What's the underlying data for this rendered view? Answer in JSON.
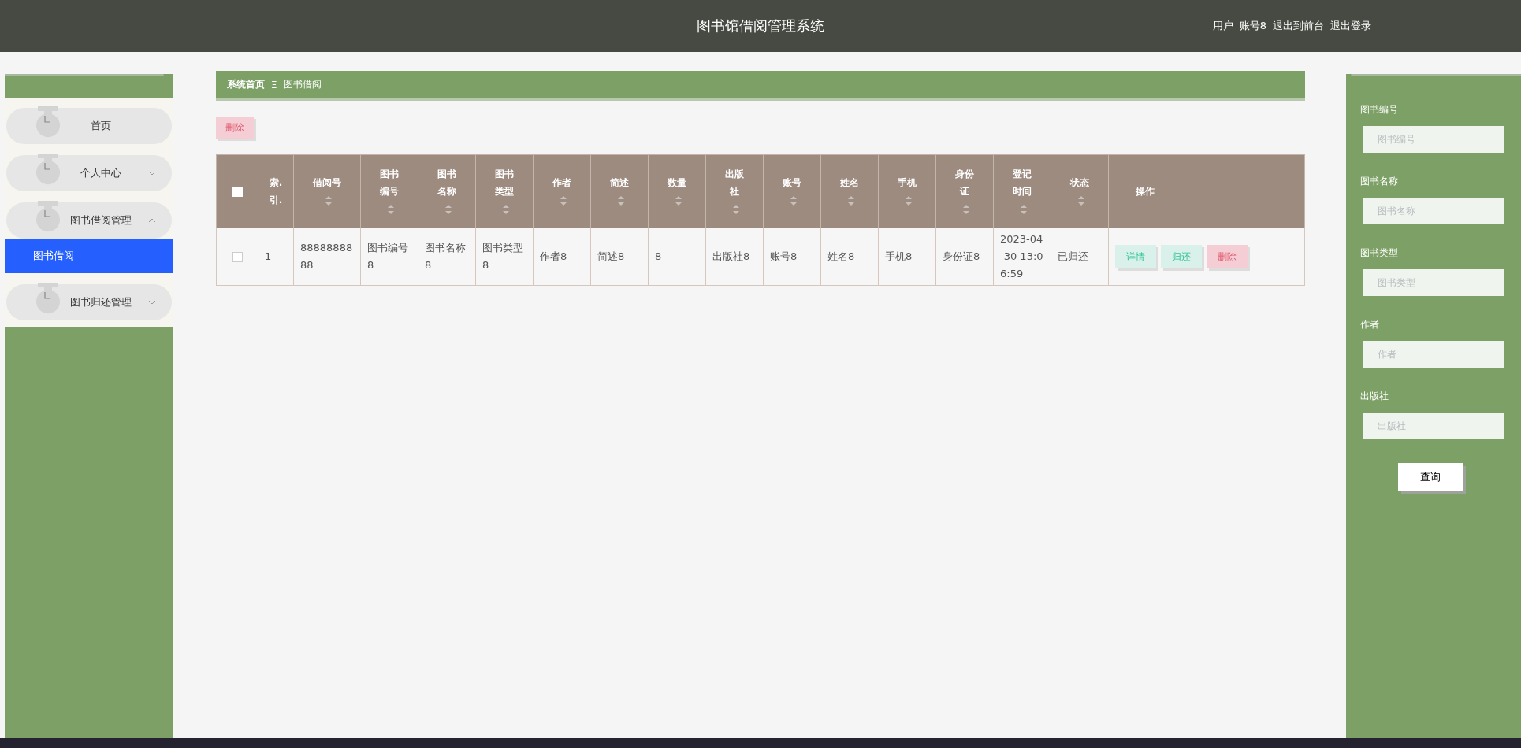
{
  "header": {
    "title": "图书馆借阅管理系统",
    "user_label": "用户",
    "user_name": "账号8",
    "links": [
      "退出到前台",
      "退出登录"
    ]
  },
  "sidebar": {
    "items": [
      {
        "kind": "link",
        "label": "首页"
      },
      {
        "kind": "group",
        "label": "个人中心",
        "expanded": false
      },
      {
        "kind": "group",
        "label": "图书借阅管理",
        "expanded": true,
        "children": [
          {
            "label": "图书借阅",
            "selected": true
          }
        ]
      },
      {
        "kind": "group",
        "label": "图书归还管理",
        "expanded": false
      }
    ]
  },
  "breadcrumb": {
    "items": [
      "系统首页",
      "图书借阅"
    ],
    "separator": "Ξ"
  },
  "toolbar": {
    "buttons": [
      {
        "kind": "delete",
        "label": "删除"
      }
    ]
  },
  "table": {
    "select_all_checked": false,
    "columns": [
      {
        "label": "索.引.",
        "sortable": false
      },
      {
        "label": "借阅号",
        "sortable": true
      },
      {
        "label": "图书编号",
        "sortable": true
      },
      {
        "label": "图书名称",
        "sortable": true
      },
      {
        "label": "图书类型",
        "sortable": true
      },
      {
        "label": "作者",
        "sortable": true
      },
      {
        "label": "简述",
        "sortable": true
      },
      {
        "label": "数量",
        "sortable": true
      },
      {
        "label": "出版社",
        "sortable": true
      },
      {
        "label": "账号",
        "sortable": true
      },
      {
        "label": "姓名",
        "sortable": true
      },
      {
        "label": "手机",
        "sortable": true
      },
      {
        "label": "身份证",
        "sortable": true
      },
      {
        "label": "登记时间",
        "sortable": true
      },
      {
        "label": "状态",
        "sortable": true
      },
      {
        "label": "操作",
        "sortable": false
      }
    ],
    "rows": [
      {
        "checked": false,
        "cells": [
          "1",
          "8888888888",
          "图书编号8",
          "图书名称8",
          "图书类型8",
          "作者8",
          "简述8",
          "8",
          "出版社8",
          "账号8",
          "姓名8",
          "手机8",
          "身份证8",
          "2023-04-30 13:06:59",
          "已归还"
        ],
        "actions": [
          {
            "kind": "detail",
            "label": "详情"
          },
          {
            "kind": "return",
            "label": "归还"
          },
          {
            "kind": "delete",
            "label": "删除"
          }
        ]
      }
    ]
  },
  "search": {
    "fields": [
      {
        "label": "图书编号",
        "placeholder": "图书编号"
      },
      {
        "label": "图书名称",
        "placeholder": "图书名称"
      },
      {
        "label": "图书类型",
        "placeholder": "图书类型"
      },
      {
        "label": "作者",
        "placeholder": "作者"
      },
      {
        "label": "出版社",
        "placeholder": "出版社"
      }
    ],
    "button": "查询"
  }
}
